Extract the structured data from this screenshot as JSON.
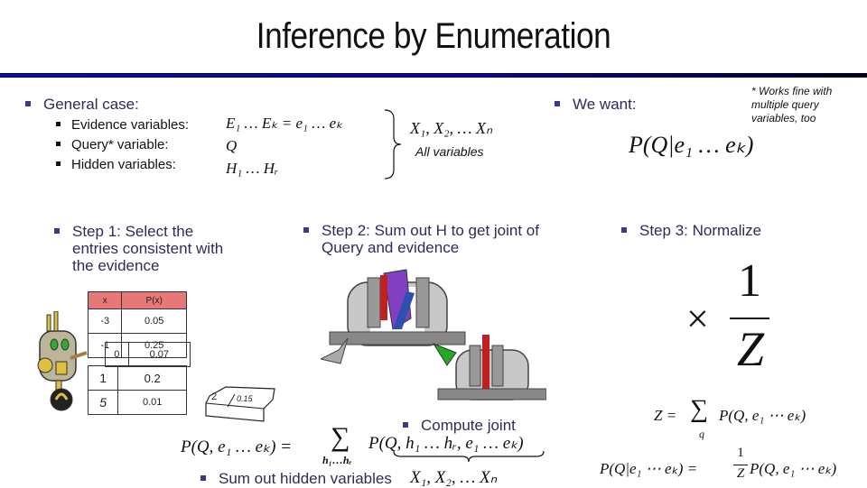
{
  "slide": {
    "title": "Inference by Enumeration",
    "accent_color": "#0a0aa8",
    "bullet_color": "#3a3a8a",
    "text_color": "#2c2c5a"
  },
  "general_case": {
    "heading": "General case:",
    "items": [
      {
        "label": "Evidence variables:",
        "math": "E₁ … Eₖ = e₁ … eₖ"
      },
      {
        "label": "Query* variable:",
        "math": "Q"
      },
      {
        "label": "Hidden variables:",
        "math": "H₁ … Hᵣ"
      }
    ],
    "all_vars_math": "X₁, X₂, … Xₙ",
    "all_vars_label": "All variables"
  },
  "we_want": {
    "heading": "We want:",
    "math": "P(Q|e₁ … eₖ)",
    "footnote": "* Works fine with multiple query variables, too"
  },
  "steps": [
    {
      "label": "Step 1: Select the entries consistent with the evidence"
    },
    {
      "label": "Step 2: Sum out H to get joint of Query and evidence"
    },
    {
      "label": "Step 3: Normalize"
    }
  ],
  "prob_table": {
    "headers": [
      "x",
      "P(x)"
    ],
    "rows": [
      {
        "x": "-3",
        "p": "0.05"
      },
      {
        "x": "-1",
        "p": "0.25"
      },
      {
        "x": "0",
        "p": "0.07"
      },
      {
        "x": "1",
        "p": "0.2"
      },
      {
        "x": "5",
        "p": "0.01"
      }
    ],
    "discarded": {
      "x": "2",
      "p": "0.15"
    }
  },
  "step2_formula": {
    "lhs": "P(Q, e₁ … eₖ) =",
    "sum_sym": "∑",
    "sum_sub": "h₁…hᵣ",
    "rhs": "P(Q, h₁ … hᵣ, e₁ … eₖ)",
    "compute_joint": "Compute joint",
    "sum_out": "Sum out hidden variables",
    "sum_out_math": "X₁, X₂, … Xₙ"
  },
  "step3_formula": {
    "times": "×",
    "num": "1",
    "den": "Z",
    "z_def_lhs": "Z =",
    "z_sum": "∑",
    "z_sub": "q",
    "z_def_rhs": "P(Q, e₁ ⋯ eₖ)",
    "final_lhs": "P(Q|e₁ ⋯ eₖ) =",
    "final_num": "1",
    "final_den": "Z",
    "final_rhs": "P(Q, e₁ ⋯ eₖ)"
  }
}
